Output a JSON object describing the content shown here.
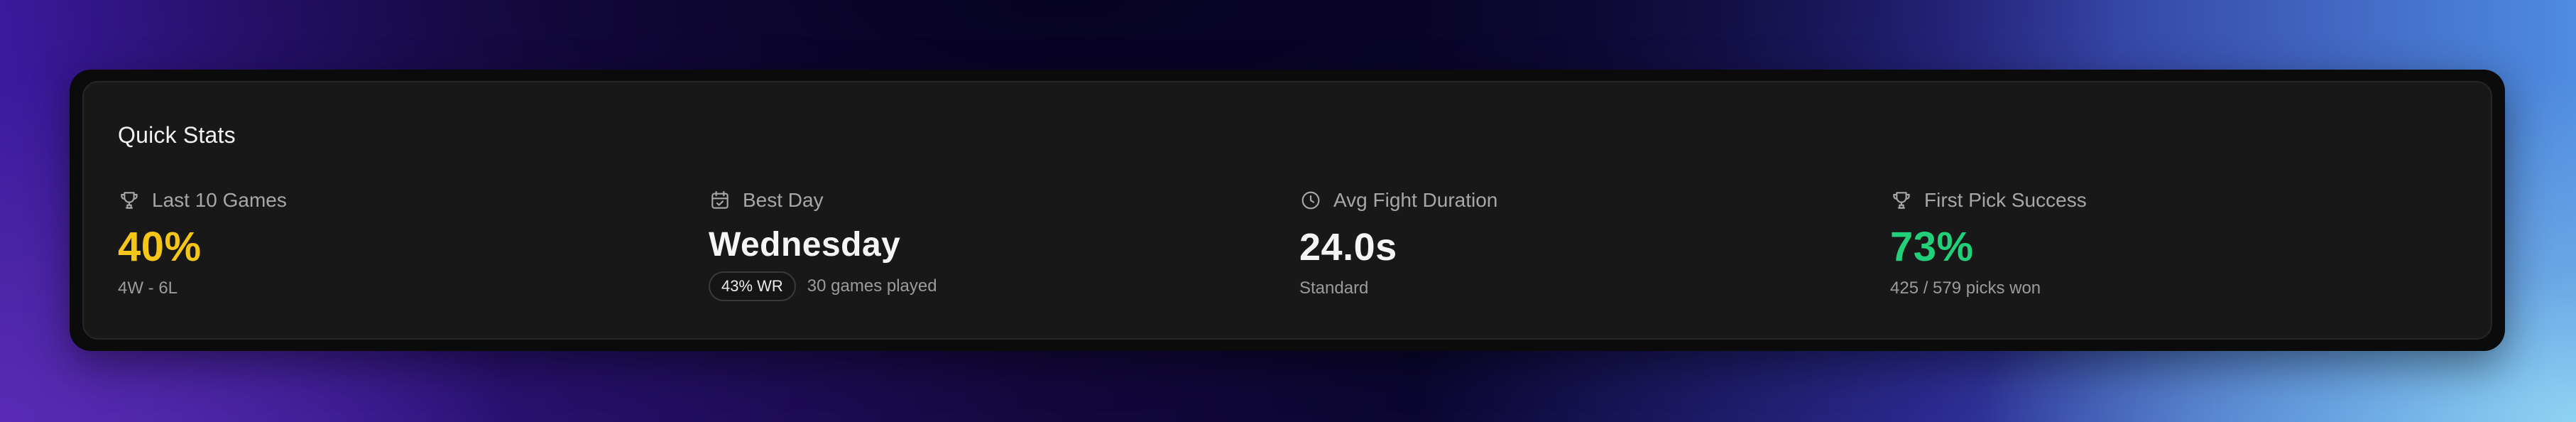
{
  "title": "Quick Stats",
  "stats": [
    {
      "icon": "trophy-icon",
      "label": "Last 10 Games",
      "value": "40%",
      "sub": "4W - 6L",
      "color": "#f5c518"
    },
    {
      "icon": "calendar-check-icon",
      "label": "Best Day",
      "value": "Wednesday",
      "badge": "43% WR",
      "sub": "30 games played",
      "color": "#f5f5f5"
    },
    {
      "icon": "clock-icon",
      "label": "Avg Fight Duration",
      "value": "24.0s",
      "sub": "Standard",
      "color": "#f5f5f5"
    },
    {
      "icon": "trophy-icon",
      "label": "First Pick Success",
      "value": "73%",
      "sub": "425 / 579 picks won",
      "color": "#22d07a"
    }
  ]
}
